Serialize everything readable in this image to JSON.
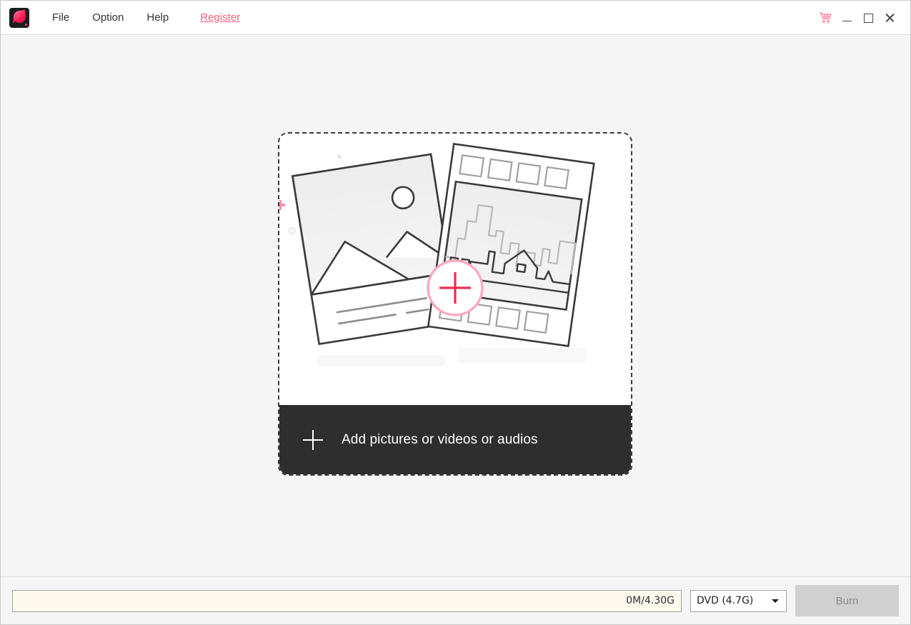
{
  "window": {
    "app_icon_name": "app-logo-icon",
    "menu": [
      {
        "label": "File"
      },
      {
        "label": "Option"
      },
      {
        "label": "Help"
      }
    ],
    "register_label": "Register",
    "controls": {
      "cart_title": "Cart",
      "minimize_title": "Minimize",
      "maximize_title": "Maximize",
      "close_title": "Close"
    }
  },
  "main": {
    "dropzone": {
      "add_label": "Add pictures or videos or audios",
      "plus_icon": "plus-icon",
      "illustration": {
        "name": "add-media-illustration",
        "photo_card": "picture-card",
        "film_card": "film-strip-card",
        "center_badge": "add-circle-plus-icon",
        "accents": [
          "pink-plus-left",
          "pink-plus-right",
          "gray-ring-left",
          "gray-ring-right",
          "gray-dot-top",
          "gray-dot-right"
        ]
      }
    }
  },
  "bottom": {
    "capacity_text": "0M/4.30G",
    "capacity_percent": 0,
    "disc_value": "DVD (4.7G)",
    "disc_options": [
      "DVD (4.7G)"
    ],
    "burn_label": "Burn",
    "burn_enabled": false
  },
  "colors": {
    "accent_pink": "#ff5f7e",
    "accent_crimson": "#f02a52",
    "title_bar_bg": "#ffffff",
    "content_bg": "#f5f5f5",
    "add_bar_bg": "#2e2e2e",
    "capacity_bg": "#fdfaed",
    "burn_bg": "#d0d0d0"
  }
}
